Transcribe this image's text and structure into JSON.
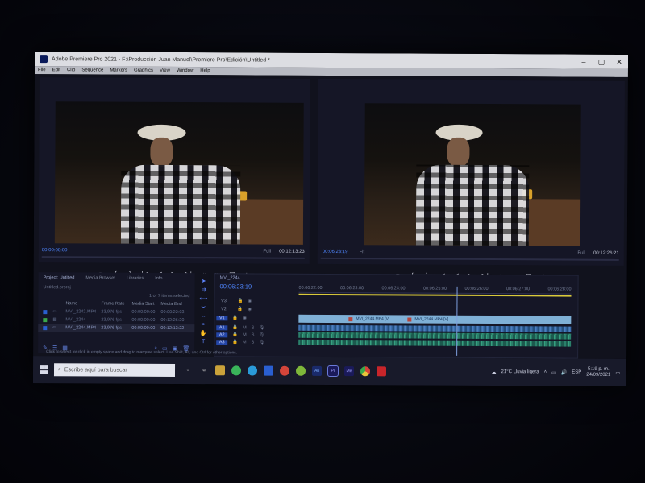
{
  "window": {
    "title": "Adobe Premiere Pro 2021 - F:\\Producción Juan Manuel\\Premiere Pro\\Edición\\Untitled *",
    "controls": [
      "–",
      "▢",
      "✕"
    ]
  },
  "menu": [
    "File",
    "Edit",
    "Clip",
    "Sequence",
    "Markers",
    "Graphics",
    "View",
    "Window",
    "Help"
  ],
  "source_monitor": {
    "timecode_start": "00:00:00:00",
    "zoom": "Full",
    "duration": "00:12:13:23"
  },
  "program_monitor": {
    "timecode": "00:06:23:19",
    "fit": "Fit",
    "zoom": "Full",
    "duration": "00:12:26:21"
  },
  "transport_labels": [
    "▾",
    "{",
    "}",
    "|◀",
    "◀",
    "▶",
    "▶|",
    "⇥",
    "⇤",
    "▣",
    "+"
  ],
  "project": {
    "tabs": [
      "Project: Untitled",
      "Media Browser",
      "Libraries",
      "Info"
    ],
    "file": "Untitled.prproj",
    "selection": "1 of 7 items selected",
    "columns": [
      "Name",
      "Frame Rate",
      "Media Start",
      "Media End"
    ],
    "rows": [
      {
        "name": "MVI_2242.MP4",
        "rate": "23,976 fps",
        "start": "00:00:00:00",
        "end": "00:00:22:03"
      },
      {
        "name": "MVI_2244",
        "rate": "23,976 fps",
        "start": "00:00:00:00",
        "end": "00:12:26:20"
      },
      {
        "name": "MVI_2244.MP4",
        "rate": "23,976 fps",
        "start": "00:00:00:00",
        "end": "00:12:13:22"
      }
    ]
  },
  "timeline": {
    "sequence": "MVI_2244",
    "timecode": "00:06:23:19",
    "ruler": [
      "00:06:22:00",
      "00:06:23:00",
      "00:06:24:00",
      "00:06:25:00",
      "00:06:26:00",
      "00:06:27:00",
      "00:06:28:00"
    ],
    "tracks": [
      {
        "label": "V3",
        "kind": "video"
      },
      {
        "label": "V2",
        "kind": "video"
      },
      {
        "label": "V1",
        "kind": "video"
      },
      {
        "label": "A1",
        "kind": "audio"
      },
      {
        "label": "A2",
        "kind": "audio"
      },
      {
        "label": "A3",
        "kind": "audio"
      }
    ],
    "clip_a": "MVI_2244.MP4 [V]",
    "clip_b": "MVI_2244.MP4 [V]"
  },
  "status_bar": "Click to select, or click in empty space and drag to marquee select. Use Shift, Alt, and Ctrl for other options.",
  "taskbar": {
    "search_placeholder": "Escribe aquí para buscar",
    "apps": [
      "WhatsApp",
      "Telegram",
      "Files",
      "Media",
      "Au",
      "Pr",
      "Me",
      "Chrome",
      "Acrobat"
    ],
    "weather": "21°C  Lluvia ligera",
    "lang": "ESP",
    "time": "5:19 p. m.",
    "date": "24/09/2021"
  },
  "colors": {
    "accent_blue": "#4f86ff",
    "titlebar": "#dcdde2",
    "workspace": "#11121d"
  }
}
